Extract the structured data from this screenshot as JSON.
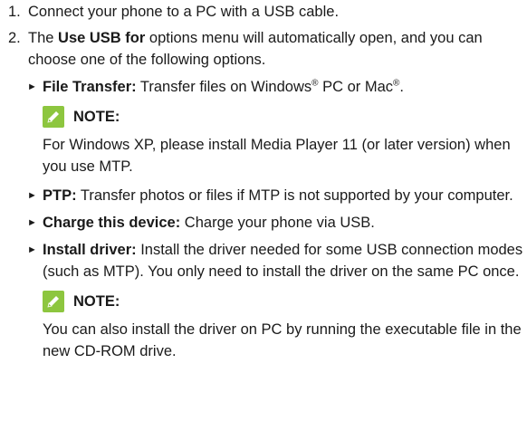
{
  "steps": [
    {
      "num": "1.",
      "text": "Connect your phone to a PC with a USB cable."
    },
    {
      "num": "2.",
      "pre": "The ",
      "bold": "Use USB for",
      "post": " options menu will automatically open, and you can choose one of the following options."
    }
  ],
  "options": {
    "file_transfer": {
      "label": "File Transfer:",
      "text_a": " Transfer files on Windows",
      "reg1": "®",
      "text_b": " PC or Mac",
      "reg2": "®",
      "text_c": "."
    },
    "note1": {
      "label": "NOTE:",
      "text": "For Windows XP, please install Media Player 11 (or later version) when you use MTP."
    },
    "ptp": {
      "label": "PTP:",
      "text": " Transfer photos or files if MTP is not supported by your computer."
    },
    "charge": {
      "label": "Charge this device:",
      "text": " Charge your phone via USB."
    },
    "install_driver": {
      "label": "Install driver:",
      "text": " Install the driver needed for some USB connection modes (such as MTP). You only need to install the driver on the same PC once."
    },
    "note2": {
      "label": "NOTE:",
      "text": "You can also install the driver on PC by running the executable file in the new CD-ROM drive."
    }
  },
  "bullet_glyph": "►",
  "icon": {
    "name": "pencil-icon",
    "color": "#8dc63f"
  }
}
